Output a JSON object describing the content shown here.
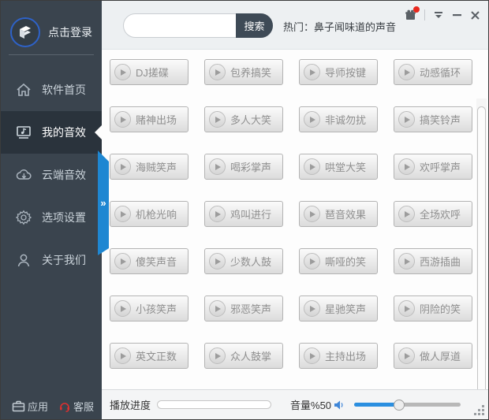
{
  "sidebar": {
    "login_label": "点击登录",
    "items": [
      {
        "label": "软件首页",
        "icon": "home-icon",
        "selected": false
      },
      {
        "label": "我的音效",
        "icon": "music-monitor-icon",
        "selected": true
      },
      {
        "label": "云端音效",
        "icon": "cloud-download-icon",
        "selected": false
      },
      {
        "label": "选项设置",
        "icon": "gear-icon",
        "selected": false
      },
      {
        "label": "关于我们",
        "icon": "user-icon",
        "selected": false
      }
    ],
    "footer": {
      "apps_label": "应用",
      "support_label": "客服"
    },
    "expand_handle_glyph": "»"
  },
  "topbar": {
    "search_value": "",
    "search_placeholder": "",
    "search_button_label": "搜索",
    "hot_label": "热门：鼻子闻味道的声音",
    "icons": [
      "gift-icon",
      "menu-chevron-icon",
      "minimize-icon",
      "close-icon"
    ]
  },
  "grid": {
    "items": [
      "DJ搓碟",
      "包养搞笑",
      "导师按键",
      "动感循环",
      "赌神出场",
      "多人大笑",
      "非诚勿扰",
      "搞笑铃声",
      "海贼笑声",
      "喝彩掌声",
      "哄堂大笑",
      "欢呼掌声",
      "机枪光响",
      "鸡叫进行",
      "琶音效果",
      "全场欢呼",
      "傻笑声音",
      "少数人鼓",
      "嘶哑的笑",
      "西游插曲",
      "小孩笑声",
      "邪恶笑声",
      "星驰笑声",
      "阴险的笑",
      "英文正数",
      "众人鼓掌",
      "主持出场",
      "做人厚道"
    ],
    "item_icon": "play-icon"
  },
  "bottombar": {
    "progress_label": "播放进度",
    "progress_percent": 0,
    "volume_label": "音量%50",
    "volume_percent": 50,
    "slider_position_percent": 42,
    "speaker_icon": "speaker-icon"
  },
  "colors": {
    "sidebar_bg": "#3a444e",
    "sidebar_selected_bg": "#2a333c",
    "accent_blue": "#1e87d2",
    "volume_blue": "#2b8fe0",
    "notification_red": "#e8281e",
    "search_button_bg": "#3e4a56",
    "button_text": "#8f8f8f"
  }
}
